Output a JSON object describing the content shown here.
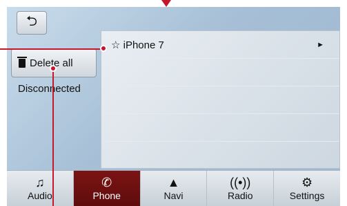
{
  "back_icon": "back-arrow-icon",
  "left_panel": {
    "delete_all_label": "Delete all",
    "delete_icon": "trash-icon",
    "status_text": "Disconnected"
  },
  "device_list": {
    "items": [
      {
        "label": "☆ iPhone 7",
        "arrow": "►"
      },
      {
        "label": ""
      },
      {
        "label": ""
      },
      {
        "label": ""
      },
      {
        "label": ""
      }
    ]
  },
  "bottom_nav": {
    "tabs": [
      {
        "label": "Audio",
        "icon": "♫",
        "active": false
      },
      {
        "label": "Phone",
        "icon": "✆",
        "active": true
      },
      {
        "label": "Navi",
        "icon": "▲",
        "active": false
      },
      {
        "label": "Radio",
        "icon": "((•))",
        "active": false
      },
      {
        "label": "Settings",
        "icon": "⚙",
        "active": false
      }
    ]
  },
  "colors": {
    "accent_red": "#c4162d",
    "active_tab": "#7b1414"
  }
}
